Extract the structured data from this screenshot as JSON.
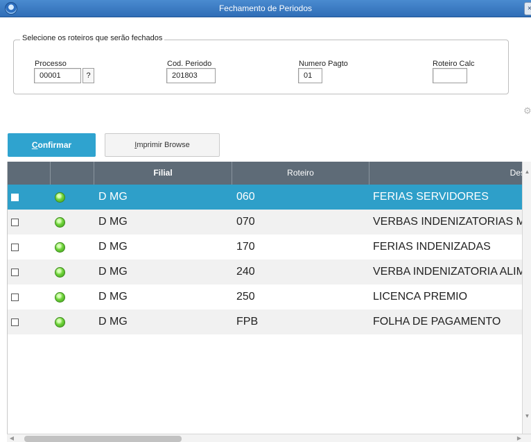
{
  "window": {
    "title": "Fechamento de Periodos",
    "close_label": "×"
  },
  "group": {
    "legend": "Selecione os roteiros que serão fechados",
    "fields": {
      "processo": {
        "label": "Processo",
        "value": "00001",
        "help": "?"
      },
      "cod_periodo": {
        "label": "Cod. Periodo",
        "value": "201803"
      },
      "numero_pagto": {
        "label": "Numero Pagto",
        "value": "01"
      },
      "roteiro_calc": {
        "label": "Roteiro Calc",
        "value": ""
      }
    }
  },
  "toolbar": {
    "confirm_label": "Confirmar",
    "print_label": "Imprimir Browse"
  },
  "grid": {
    "columns": [
      "",
      "",
      "Filial",
      "Roteiro",
      "Des"
    ],
    "rows": [
      {
        "filial": "D MG",
        "roteiro": "060",
        "descricao": "FERIAS SERVIDORES",
        "selected": true
      },
      {
        "filial": "D MG",
        "roteiro": "070",
        "descricao": "VERBAS INDENIZATORIAS M",
        "selected": false
      },
      {
        "filial": "D MG",
        "roteiro": "170",
        "descricao": "FERIAS INDENIZADAS",
        "selected": false
      },
      {
        "filial": "D MG",
        "roteiro": "240",
        "descricao": "VERBA INDENIZATORIA ALIM",
        "selected": false
      },
      {
        "filial": "D MG",
        "roteiro": "250",
        "descricao": "LICENCA PREMIO",
        "selected": false
      },
      {
        "filial": "D MG",
        "roteiro": "FPB",
        "descricao": "FOLHA DE PAGAMENTO",
        "selected": false
      }
    ]
  },
  "colors": {
    "titlebar": "#2f6db6",
    "accent": "#2fa3cf",
    "header": "#5e6b77",
    "status_ok": "#6fd33a"
  },
  "icons": [
    "app-icon",
    "close-icon",
    "help-icon",
    "gear-icon",
    "status-ok-icon",
    "checkbox-icon"
  ]
}
